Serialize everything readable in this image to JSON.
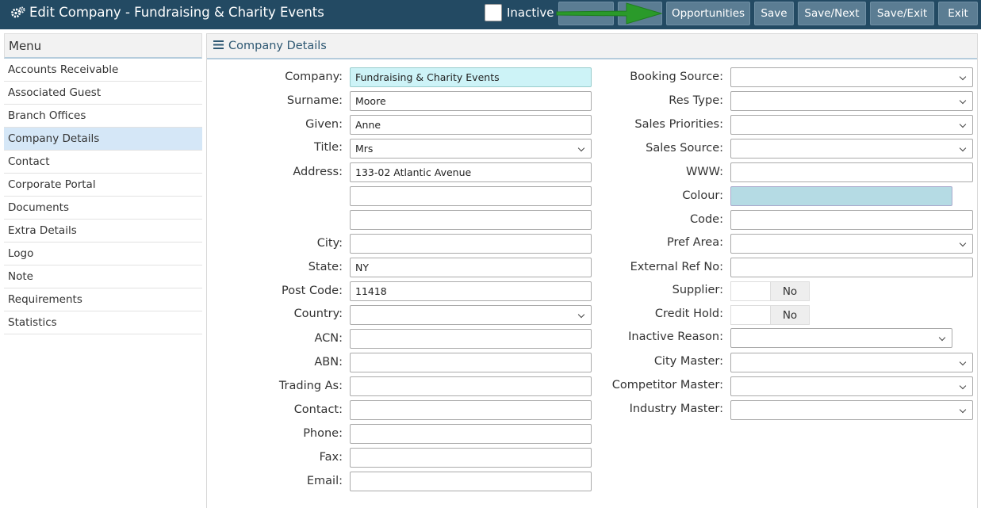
{
  "header": {
    "title": "Edit Company - Fundraising & Charity Events",
    "inactive_label": "Inactive",
    "buttons": {
      "opportunities": "Opportunities",
      "save": "Save",
      "save_next": "Save/Next",
      "save_exit": "Save/Exit",
      "exit": "Exit"
    }
  },
  "sidebar": {
    "title": "Menu",
    "items": [
      {
        "label": "Accounts Receivable"
      },
      {
        "label": "Associated Guest"
      },
      {
        "label": "Branch Offices"
      },
      {
        "label": "Company Details"
      },
      {
        "label": "Contact"
      },
      {
        "label": "Corporate Portal"
      },
      {
        "label": "Documents"
      },
      {
        "label": "Extra Details"
      },
      {
        "label": "Logo"
      },
      {
        "label": "Note"
      },
      {
        "label": "Requirements"
      },
      {
        "label": "Statistics"
      }
    ],
    "active": "Company Details"
  },
  "panel": {
    "title": "Company Details"
  },
  "left_form": {
    "company": {
      "label": "Company:",
      "value": "Fundraising & Charity Events"
    },
    "surname": {
      "label": "Surname:",
      "value": "Moore"
    },
    "given": {
      "label": "Given:",
      "value": "Anne"
    },
    "title": {
      "label": "Title:",
      "value": "Mrs"
    },
    "address": {
      "label": "Address:",
      "line1": "133-02 Atlantic Avenue",
      "line2": "",
      "line3": ""
    },
    "city": {
      "label": "City:",
      "value": ""
    },
    "state": {
      "label": "State:",
      "value": "NY"
    },
    "postcode": {
      "label": "Post Code:",
      "value": "11418"
    },
    "country": {
      "label": "Country:",
      "value": ""
    },
    "acn": {
      "label": "ACN:",
      "value": ""
    },
    "abn": {
      "label": "ABN:",
      "value": ""
    },
    "trading_as": {
      "label": "Trading As:",
      "value": ""
    },
    "contact": {
      "label": "Contact:",
      "value": ""
    },
    "phone": {
      "label": "Phone:",
      "value": ""
    },
    "fax": {
      "label": "Fax:",
      "value": ""
    },
    "email": {
      "label": "Email:",
      "value": ""
    }
  },
  "right_form": {
    "booking_source": {
      "label": "Booking Source:",
      "value": ""
    },
    "res_type": {
      "label": "Res Type:",
      "value": ""
    },
    "sales_priorities": {
      "label": "Sales Priorities:",
      "value": ""
    },
    "sales_source": {
      "label": "Sales Source:",
      "value": ""
    },
    "www": {
      "label": "WWW:",
      "value": ""
    },
    "colour": {
      "label": "Colour:",
      "value": "#b5dbe4"
    },
    "code": {
      "label": "Code:",
      "value": ""
    },
    "pref_area": {
      "label": "Pref Area:",
      "value": ""
    },
    "external_ref": {
      "label": "External Ref No:",
      "value": ""
    },
    "supplier": {
      "label": "Supplier:",
      "value": "No"
    },
    "credit_hold": {
      "label": "Credit Hold:",
      "value": "No"
    },
    "inactive_reason": {
      "label": "Inactive Reason:",
      "value": ""
    },
    "city_master": {
      "label": "City Master:",
      "value": ""
    },
    "competitor_master": {
      "label": "Competitor Master:",
      "value": ""
    },
    "industry_master": {
      "label": "Industry Master:",
      "value": ""
    }
  },
  "colors": {
    "header_bg": "#234a63",
    "button_bg": "#5b7d93",
    "active_item": "#d5e7f7",
    "highlight_input": "#cdf3f7",
    "arrow": "#2a9a2a"
  },
  "icons": {
    "title": "gears-icon",
    "panel": "hamburger-menu-icon",
    "annotation": "green-arrow-icon"
  }
}
